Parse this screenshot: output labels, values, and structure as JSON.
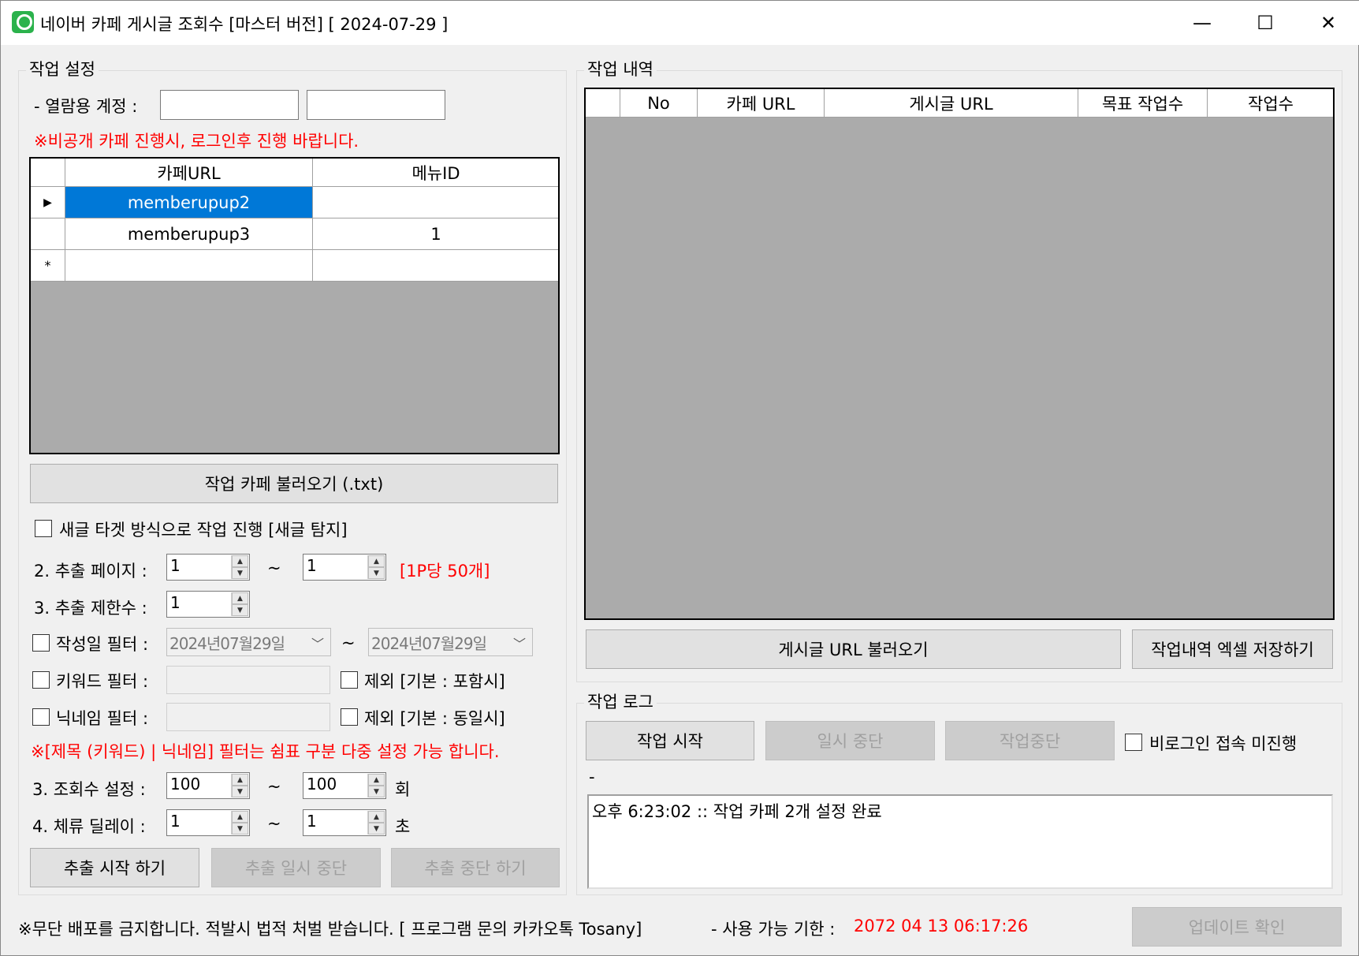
{
  "window": {
    "title": "네이버 카페 게시글 조회수 [마스터 버전] [ 2024-07-29 ]",
    "controls": {
      "minimize": "—",
      "maximize": "☐",
      "close": "✕"
    }
  },
  "settings": {
    "group_label": "작업 설정",
    "account_label": "- 열람용 계정 :",
    "account_id_value": "",
    "account_pw_value": "",
    "private_notice": "※비공개 카페 진행시, 로그인후 진행 바랍니다.",
    "cafe_grid": {
      "columns": [
        "카페URL",
        "메뉴ID"
      ],
      "rows": [
        {
          "marker": "▶",
          "cafe_url": "memberupup2",
          "menu_id": ""
        },
        {
          "marker": "",
          "cafe_url": "memberupup3",
          "menu_id": "1"
        },
        {
          "marker": "*",
          "cafe_url": "",
          "menu_id": ""
        }
      ]
    },
    "load_cafe_button": "작업 카페 불러오기 (.txt)",
    "new_post_target_label": "새글 타겟 방식으로 작업 진행 [새글 탐지]",
    "extract_page_label": "2. 추출 페이지 :",
    "extract_page_from": "1",
    "extract_page_to": "1",
    "tilde": "~",
    "per_page_note": "[1P당 50개]",
    "extract_limit_label": "3. 추출 제한수 :",
    "extract_limit_value": "1",
    "date_filter_label": "작성일 필터 :",
    "date_from": "2024년07월29일",
    "date_to": "2024년07월29일",
    "keyword_filter_label": "키워드 필터 :",
    "keyword_value": "",
    "keyword_exclude_label": "제외 [기본 : 포함시]",
    "nickname_filter_label": "닉네임 필터 :",
    "nickname_value": "",
    "nickname_exclude_label": "제외 [기본 : 동일시]",
    "filter_notice": "※[제목 (키워드) | 닉네임] 필터는 쉼표 구분 다중 설정 가능 합니다.",
    "view_count_label": "3. 조회수 설정 :",
    "view_count_from": "100",
    "view_count_to": "100",
    "view_count_unit": "회",
    "delay_label": "4. 체류 딜레이 :",
    "delay_from": "1",
    "delay_to": "1",
    "delay_unit": "초",
    "start_extract_button": "추출 시작 하기",
    "pause_extract_button": "추출 일시 중단",
    "stop_extract_button": "추출 중단 하기"
  },
  "history": {
    "group_label": "작업 내역",
    "columns": [
      "No",
      "카페 URL",
      "게시글 URL",
      "목표 작업수",
      "작업수"
    ],
    "load_posts_button": "게시글 URL 불러오기",
    "save_excel_button": "작업내역 엑셀 저장하기"
  },
  "log": {
    "group_label": "작업 로그",
    "start_button": "작업 시작",
    "pause_button": "일시 중단",
    "stop_button": "작업중단",
    "no_login_label": "비로그인 접속 미진행",
    "status_text": "-",
    "entries": "오후 6:23:02 :: 작업 카페 2개 설정 완료"
  },
  "footer": {
    "notice": "※무단 배포를 금지합니다. 적발시 법적 처벌 받습니다. [ 프로그램 문의 카카오톡 Tosany]",
    "expiry_label": "- 사용 가능 기한 :",
    "expiry_value": "2072 04 13 06:17:26",
    "update_button": "업데이트 확인"
  },
  "colors": {
    "accent_selection": "#0078d7",
    "warning_text": "#ff0000",
    "grid_background": "#ababab",
    "window_background": "#f0f0f0"
  }
}
